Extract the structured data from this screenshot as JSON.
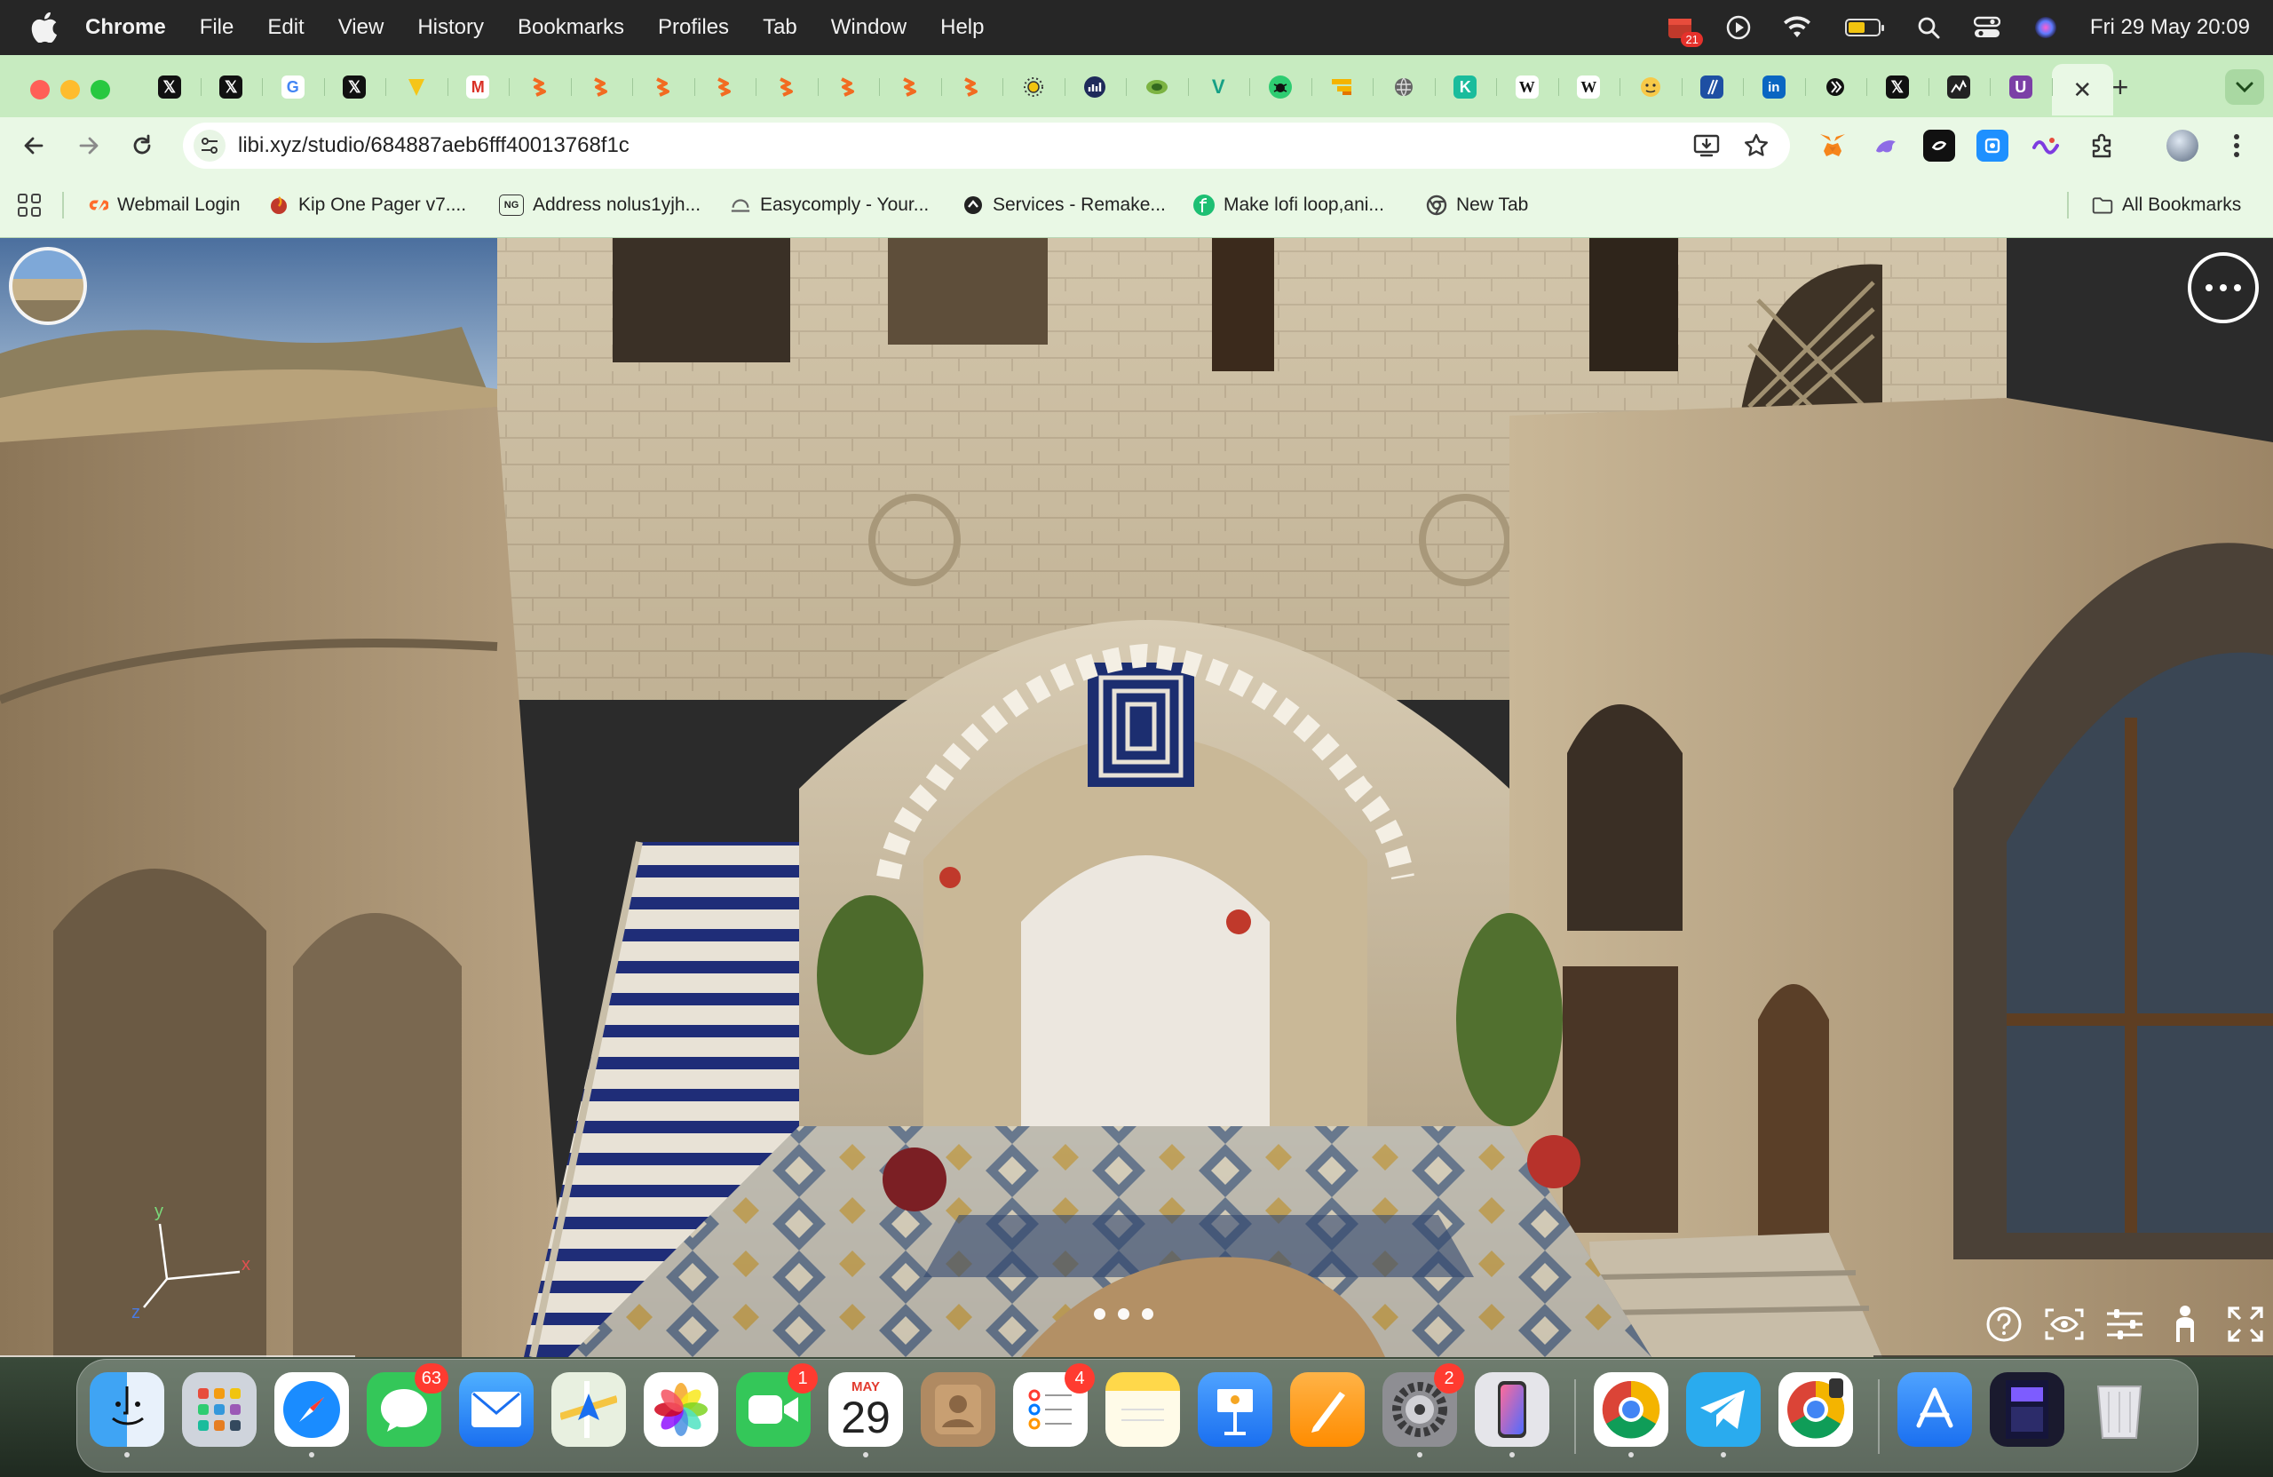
{
  "menubar": {
    "app_name": "Chrome",
    "menus": [
      "File",
      "Edit",
      "View",
      "History",
      "Bookmarks",
      "Profiles",
      "Tab",
      "Window",
      "Help"
    ],
    "calendar_badge": "21",
    "clock": "Fri 29 May  20:09",
    "battery_level": 0.55
  },
  "tabs": {
    "favicons": [
      "x-icon",
      "x-icon",
      "google-icon",
      "x-icon",
      "yellow-icon",
      "gmail-icon",
      "orange-icon",
      "orange-icon",
      "orange-icon",
      "orange-icon",
      "orange-icon",
      "orange-icon",
      "orange-icon",
      "orange-icon",
      "sun-icon",
      "chart-icon",
      "green-icon",
      "v-icon",
      "bug-icon",
      "slides-icon",
      "globe-icon",
      "k-icon",
      "wikipedia-icon",
      "wikipedia-icon",
      "emoji-icon",
      "blue-slash-icon",
      "linkedin-icon",
      "brand-icon",
      "x-icon",
      "chart-dark-icon",
      "u-icon"
    ],
    "x_glyph": "𝕏",
    "w_glyph": "W",
    "in_glyph": "in",
    "g_glyph": "G",
    "m_glyph": "M",
    "k_glyph": "K",
    "u_glyph": "U",
    "v_glyph": "V",
    "active_close": "✕",
    "new_tab": "+"
  },
  "toolbar": {
    "url": "libi.xyz/studio/684887aeb6fff40013768f1c"
  },
  "bookmarks": {
    "items": [
      {
        "label": "Webmail Login",
        "icon": "cpanel-icon",
        "color": "#ff6c2c"
      },
      {
        "label": "Kip One Pager v7....",
        "icon": "kip-icon",
        "color": "#c0392b"
      },
      {
        "label": "Address nolus1yjh...",
        "icon": "ng-icon",
        "color": "#ffffff"
      },
      {
        "label": "Easycomply - Your...",
        "icon": "easycomply-icon",
        "color": "#888888"
      },
      {
        "label": "Services - Remake...",
        "icon": "remake-icon",
        "color": "#222222"
      },
      {
        "label": "Make lofi loop,ani...",
        "icon": "fiverr-icon",
        "color": "#1dbf73"
      },
      {
        "label": "New Tab",
        "icon": "chrome-icon",
        "color": "#444444"
      }
    ],
    "ng_text": "NG",
    "all_bookmarks": "All Bookmarks"
  },
  "viewer": {
    "axes": {
      "x": "x",
      "y": "y",
      "z": "z"
    },
    "pager_count": 3
  },
  "dock": {
    "apps": [
      {
        "name": "finder"
      },
      {
        "name": "launchpad"
      },
      {
        "name": "safari"
      },
      {
        "name": "messages",
        "badge": "63"
      },
      {
        "name": "mail"
      },
      {
        "name": "maps"
      },
      {
        "name": "photos"
      },
      {
        "name": "facetime",
        "badge": "1"
      },
      {
        "name": "calendar",
        "month": "MAY",
        "day": "29"
      },
      {
        "name": "contacts"
      },
      {
        "name": "reminders",
        "badge": "4"
      },
      {
        "name": "notes"
      },
      {
        "name": "keynote"
      },
      {
        "name": "pages"
      },
      {
        "name": "system-settings",
        "badge": "2"
      },
      {
        "name": "iphone-mirroring"
      },
      {
        "name": "chrome"
      },
      {
        "name": "telegram"
      },
      {
        "name": "chrome-profile"
      },
      {
        "name": "app-store"
      },
      {
        "name": "document"
      },
      {
        "name": "trash"
      }
    ]
  }
}
